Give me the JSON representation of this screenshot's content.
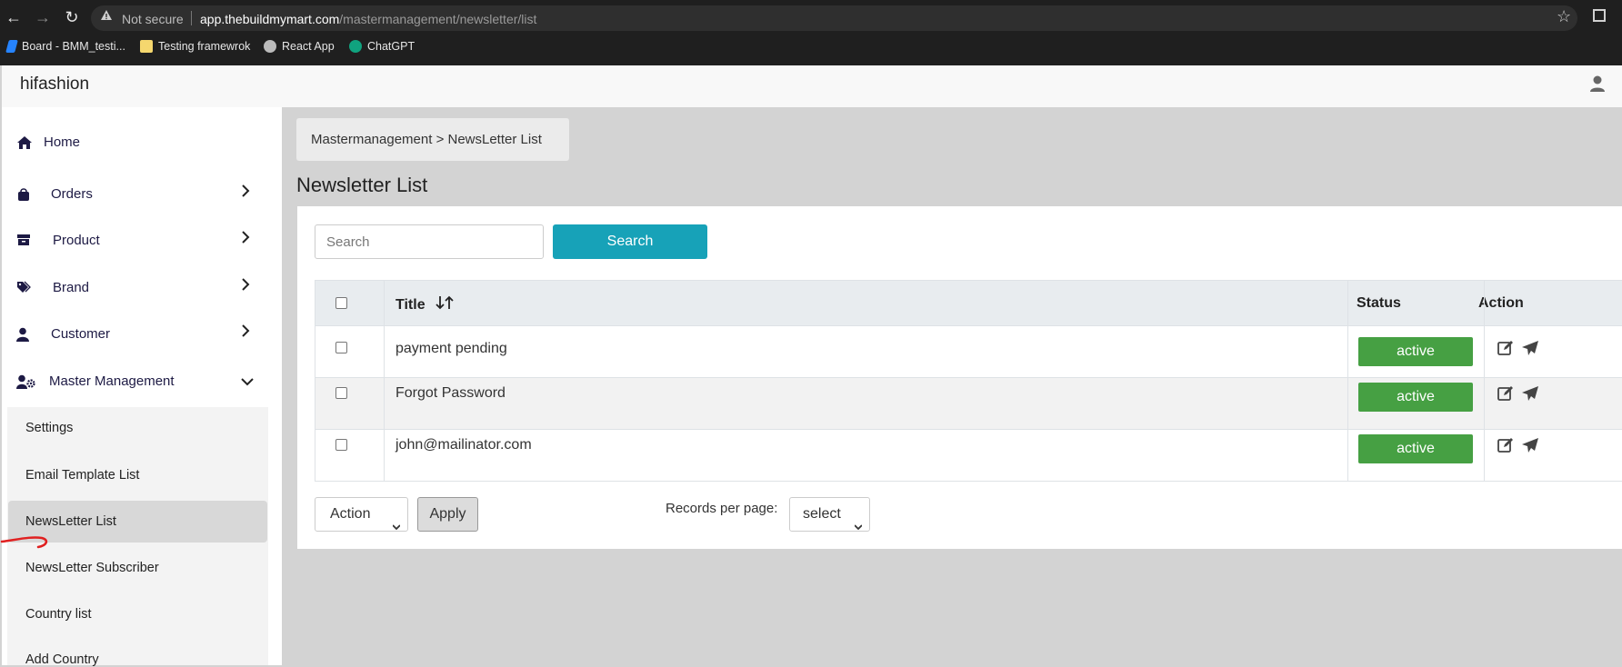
{
  "browser": {
    "security_label": "Not secure",
    "url_host": "app.thebuildmymart.com",
    "url_path": "/mastermanagement/newsletter/list",
    "bookmarks": [
      {
        "label": "Board - BMM_testi...",
        "icon": "jira-icon",
        "color": "#2684ff"
      },
      {
        "label": "Testing framewrok",
        "icon": "folder-icon",
        "color": "#f5d76e"
      },
      {
        "label": "React App",
        "icon": "globe-icon",
        "color": "#bbbbbb"
      },
      {
        "label": "ChatGPT",
        "icon": "chatgpt-icon",
        "color": "#10a37f"
      }
    ]
  },
  "app": {
    "brand": "hifashion",
    "user_icon": "user-icon"
  },
  "sidebar": {
    "items": [
      {
        "label": "Home",
        "icon": "home-icon",
        "has_chevron": false
      },
      {
        "label": "Orders",
        "icon": "bag-icon",
        "has_chevron": true
      },
      {
        "label": "Product",
        "icon": "box-icon",
        "has_chevron": true
      },
      {
        "label": "Brand",
        "icon": "tags-icon",
        "has_chevron": true
      },
      {
        "label": "Customer",
        "icon": "user-icon",
        "has_chevron": true
      },
      {
        "label": "Master Management",
        "icon": "user-gear-icon",
        "has_chevron": true,
        "expanded": true
      }
    ],
    "submenu": [
      {
        "label": "Settings"
      },
      {
        "label": "Email Template List"
      },
      {
        "label": "NewsLetter List",
        "active": true
      },
      {
        "label": "NewsLetter Subscriber"
      },
      {
        "label": "Country list"
      },
      {
        "label": "Add Country"
      }
    ]
  },
  "main": {
    "breadcrumb": "Mastermanagement > NewsLetter List",
    "title": "Newsletter List",
    "search": {
      "placeholder": "Search",
      "button": "Search"
    },
    "table": {
      "headers": {
        "title": "Title",
        "sort_icon": "sort-arrows-icon",
        "status": "Status",
        "action": "Action"
      },
      "rows": [
        {
          "title": "payment pending",
          "status": "active"
        },
        {
          "title": "Forgot Password",
          "status": "active"
        },
        {
          "title": "john@mailinator.com",
          "status": "active"
        }
      ]
    },
    "bulk": {
      "select_value": "Action",
      "apply_label": "Apply"
    },
    "pagination": {
      "label": "Records per page:",
      "select_value": "select"
    }
  },
  "colors": {
    "search_button": "#17a2b8",
    "status_active": "#46a043",
    "sidebar_text": "#1d1a44"
  }
}
